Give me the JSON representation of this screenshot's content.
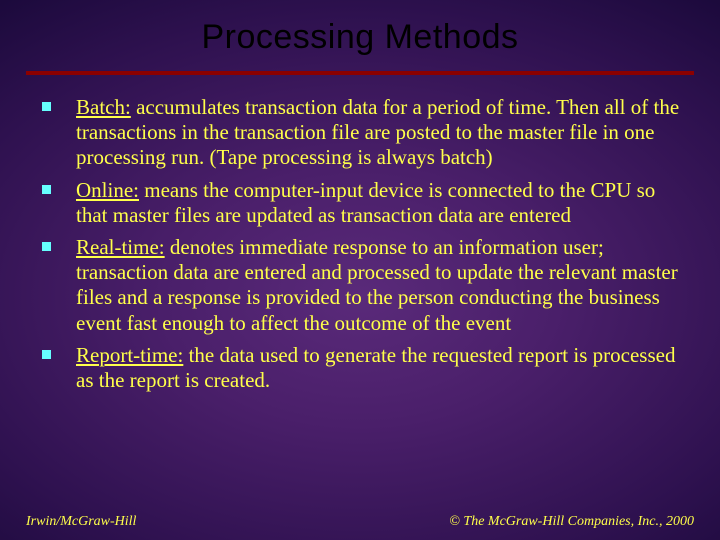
{
  "title": "Processing Methods",
  "bullets": [
    {
      "term": "Batch:",
      "text": " accumulates transaction data for a period of time.  Then all of the transactions in the transaction file are posted to the master file in one processing run. (Tape processing is always batch)"
    },
    {
      "term": "Online:",
      "text": " means the computer-input device is connected to the CPU so that master files are updated as transaction data are entered"
    },
    {
      "term": "Real-time:",
      "text": " denotes immediate response to an information user; transaction data are entered and processed to update the relevant master files and a response is provided to the person conducting the business event fast enough to affect the outcome of the event"
    },
    {
      "term": "Report-time:",
      "text": " the data used to generate the requested report is processed as the report is created."
    }
  ],
  "footer": {
    "left": "Irwin/McGraw-Hill",
    "right": "© The McGraw-Hill Companies, Inc., 2000"
  }
}
